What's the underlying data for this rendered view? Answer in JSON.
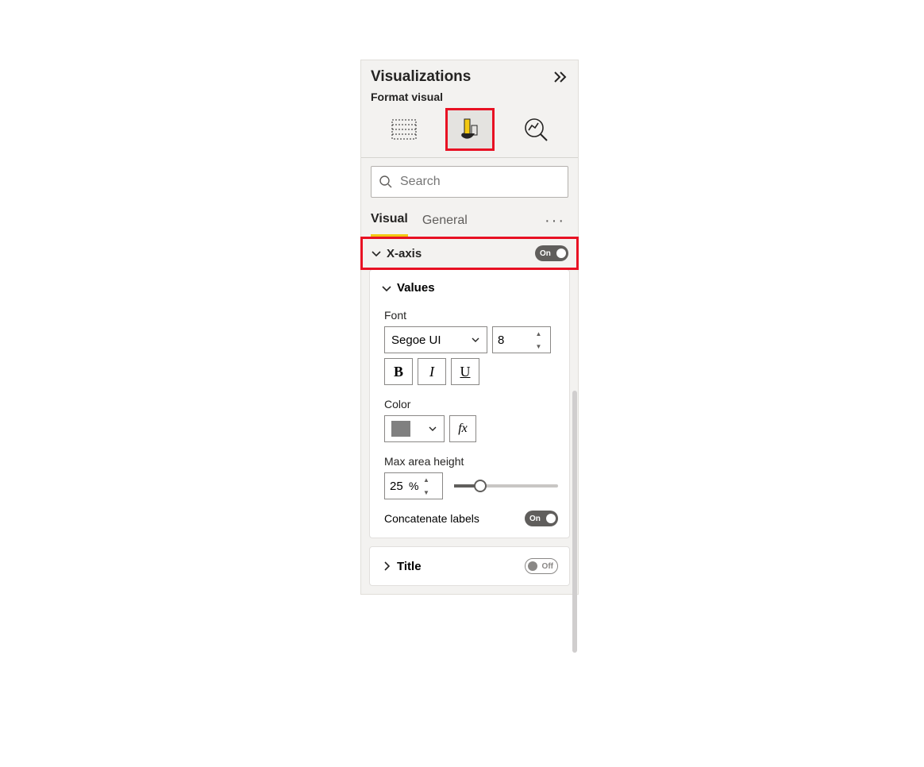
{
  "panel": {
    "title": "Visualizations",
    "subtitle": "Format visual",
    "search_placeholder": "Search",
    "tabs": {
      "visual": "Visual",
      "general": "General"
    }
  },
  "sections": {
    "xaxis": {
      "label": "X-axis",
      "toggle_label": "On"
    },
    "values": {
      "label": "Values",
      "font_label": "Font",
      "font_family": "Segoe UI",
      "font_size": "8",
      "color_label": "Color",
      "color_value": "#808080",
      "max_height_label": "Max area height",
      "max_height_value": "25",
      "max_height_unit": "%",
      "concat_label": "Concatenate labels",
      "concat_toggle_label": "On"
    },
    "title": {
      "label": "Title",
      "toggle_label": "Off"
    }
  },
  "icons": {
    "bold_letter": "B",
    "italic_letter": "I",
    "underline_letter": "U",
    "fx": "fx",
    "ellipsis": "···"
  }
}
